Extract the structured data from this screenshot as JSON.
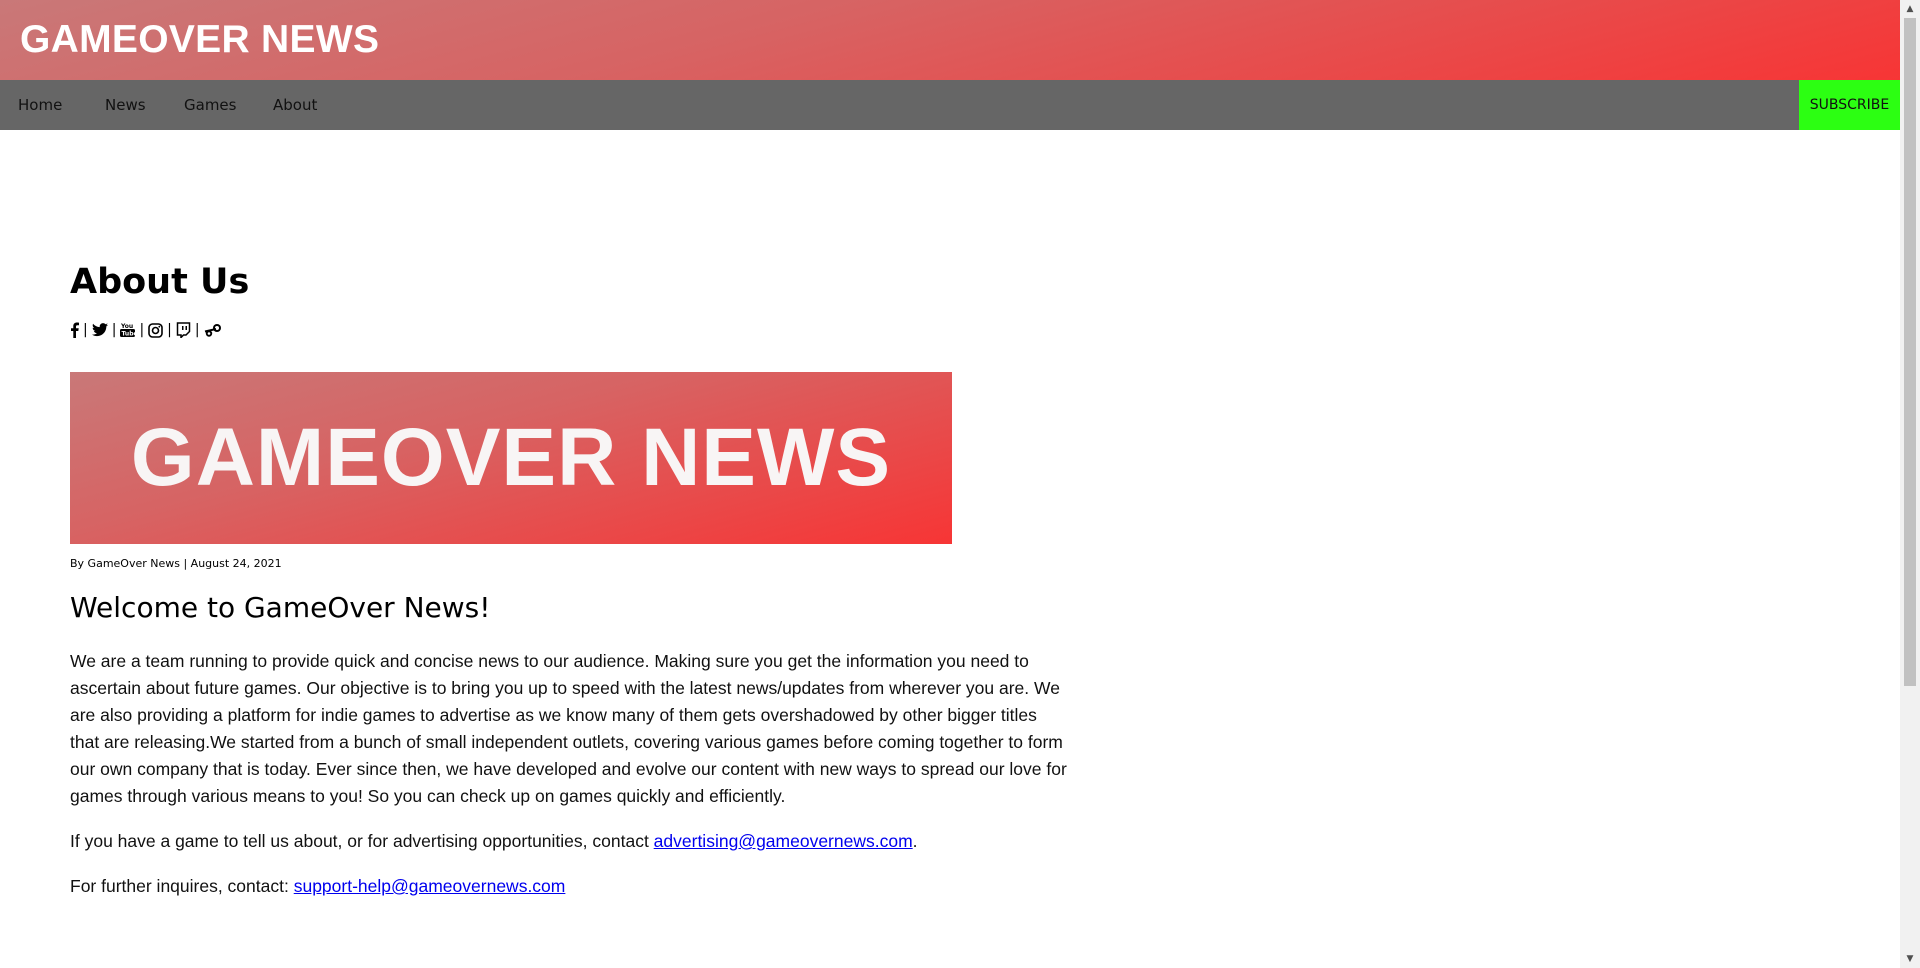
{
  "header": {
    "title": "GAMEOVER NEWS"
  },
  "nav": {
    "items": [
      {
        "label": "Home"
      },
      {
        "label": "News"
      },
      {
        "label": "Games"
      },
      {
        "label": "About"
      }
    ],
    "subscribe_label": "SUBSCRIBE",
    "subscribe_color": "#2cff12"
  },
  "main": {
    "heading": "About Us",
    "social_icons": [
      "facebook-icon",
      "twitter-icon",
      "youtube-icon",
      "instagram-icon",
      "twitch-icon",
      "steam-icon"
    ],
    "separator": "|",
    "banner_text": "GAMEOVER NEWS",
    "byline": "By GameOver News | August 24, 2021",
    "welcome": "Welcome to GameOver News!",
    "paragraph1": "We are a team running to provide quick and concise news to our audience. Making sure you get the information you need to ascertain about future games. Our objective is to bring you up to speed with the latest news/updates from wherever you are. We are also providing a platform for indie games to advertise as we know many of them gets overshadowed by other bigger titles that are releasing.We started from a bunch of small independent outlets, covering various games before coming together to form our own company that is today. Ever since then, we have developed and evolve our content with new ways to spread our love for games through various means to you! So you can check up on games quickly and efficiently.",
    "paragraph2_prefix": "If you have a game to tell us about, or for advertising opportunities, contact ",
    "advertising_email": "advertising@gameovernews.com",
    "paragraph2_suffix": ".",
    "paragraph3_prefix": "For further inquires, contact: ",
    "support_email": "support-help@gameovernews.com"
  },
  "colors": {
    "header_gradient_start": "#c97878",
    "header_gradient_end": "#f73535",
    "nav_background": "#666666",
    "link": "#0000ee"
  }
}
